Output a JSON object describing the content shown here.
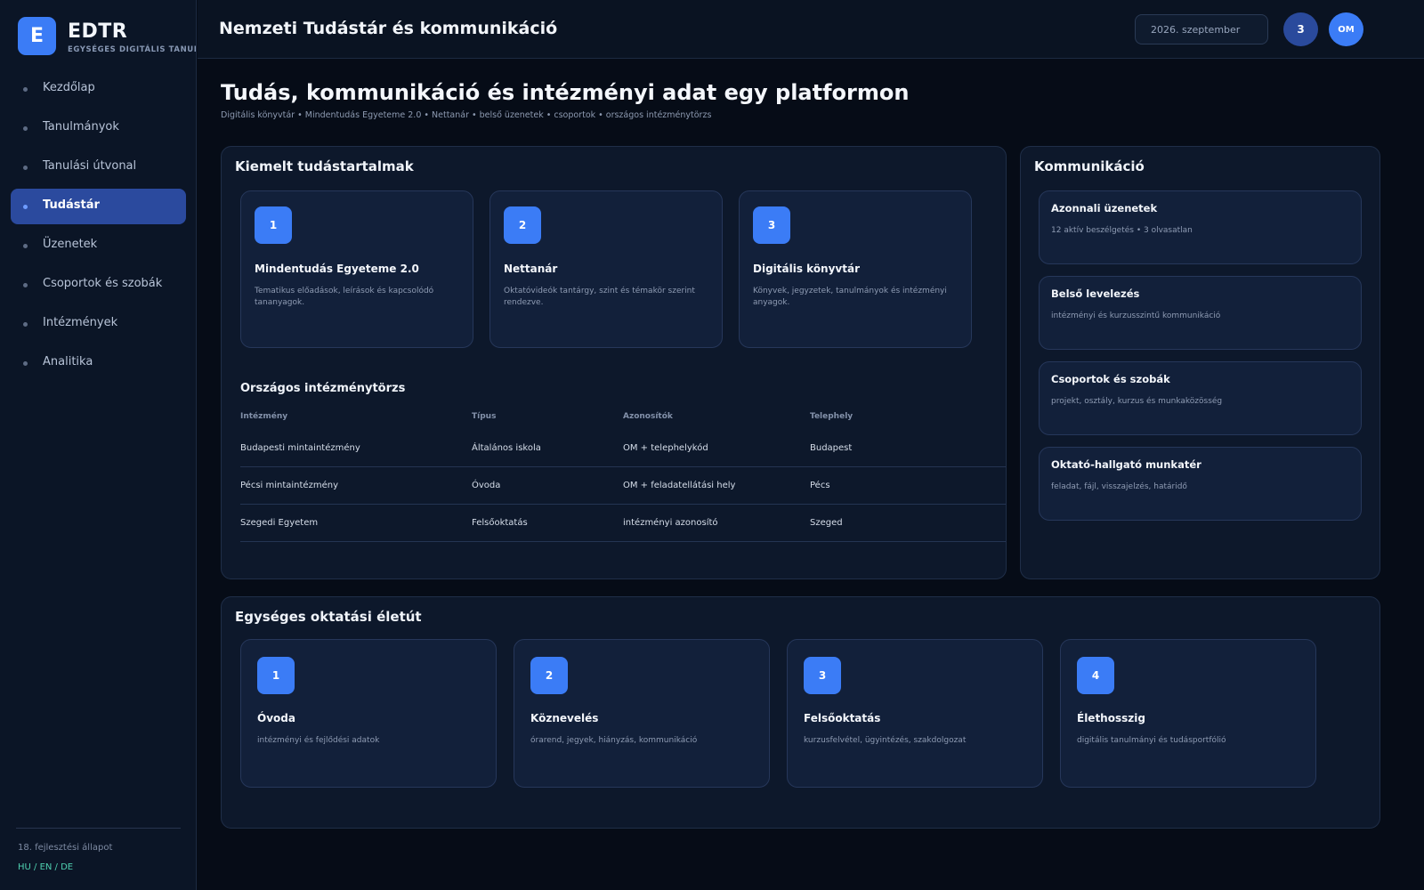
{
  "brand": {
    "logo_letter": "E",
    "name": "EDTR",
    "subtitle": "EGYSÉGES DIGITÁLIS TANULMÁNYI RENDSZER"
  },
  "sidebar": {
    "items": [
      {
        "label": "Kezdőlap",
        "active": false
      },
      {
        "label": "Tanulmányok",
        "active": false
      },
      {
        "label": "Tanulási útvonal",
        "active": false
      },
      {
        "label": "Tudástár",
        "active": true
      },
      {
        "label": "Üzenetek",
        "active": false
      },
      {
        "label": "Csoportok és szobák",
        "active": false
      },
      {
        "label": "Intézmények",
        "active": false
      },
      {
        "label": "Analitika",
        "active": false
      }
    ],
    "status": "18. fejlesztési állapot",
    "languages": "HU / EN / DE"
  },
  "header": {
    "title": "Nemzeti Tudástár és kommunikáció",
    "date": "2026. szeptember",
    "notification_count": "3",
    "avatar_initials": "OM"
  },
  "main": {
    "title": "Tudás, kommunikáció és intézményi adat egy platformon",
    "subtitle": "Digitális könyvtár • Mindentudás Egyeteme 2.0 • Nettanár • belső üzenetek • csoportok • országos intézménytörzs"
  },
  "knowledge": {
    "title": "Kiemelt tudástartalmak",
    "cards": [
      {
        "num": "1",
        "title": "Mindentudás Egyeteme 2.0",
        "desc": "Tematikus előadások, leírások és kapcsolódó tananyagok."
      },
      {
        "num": "2",
        "title": "Nettanár",
        "desc": "Oktatóvideók tantárgy, szint és témakör szerint rendezve."
      },
      {
        "num": "3",
        "title": "Digitális könyvtár",
        "desc": "Könyvek, jegyzetek, tanulmányok és intézményi anyagok."
      }
    ]
  },
  "institutions": {
    "title": "Országos intézménytörzs",
    "columns": [
      "Intézmény",
      "Típus",
      "Azonosítók",
      "Telephely"
    ],
    "rows": [
      [
        "Budapesti mintaintézmény",
        "Általános iskola",
        "OM + telephelykód",
        "Budapest"
      ],
      [
        "Pécsi mintaintézmény",
        "Óvoda",
        "OM + feladatellátási hely",
        "Pécs"
      ],
      [
        "Szegedi Egyetem",
        "Felsőoktatás",
        "intézményi azonosító",
        "Szeged"
      ]
    ]
  },
  "communication": {
    "title": "Kommunikáció",
    "cards": [
      {
        "title": "Azonnali üzenetek",
        "desc": "12 aktív beszélgetés • 3 olvasatlan"
      },
      {
        "title": "Belső levelezés",
        "desc": "intézményi és kurzusszintű kommunikáció"
      },
      {
        "title": "Csoportok és szobák",
        "desc": "projekt, osztály, kurzus és munkaközösség"
      },
      {
        "title": "Oktató-hallgató munkatér",
        "desc": "feladat, fájl, visszajelzés, határidő"
      }
    ]
  },
  "lifepath": {
    "title": "Egységes oktatási életút",
    "cards": [
      {
        "num": "1",
        "title": "Óvoda",
        "desc": "intézményi és fejlődési adatok"
      },
      {
        "num": "2",
        "title": "Köznevelés",
        "desc": "órarend, jegyek, hiányzás, kommunikáció"
      },
      {
        "num": "3",
        "title": "Felsőoktatás",
        "desc": "kurzusfelvétel, ügyintézés, szakdolgozat"
      },
      {
        "num": "4",
        "title": "Élethosszig",
        "desc": "digitális tanulmányi és tudásportfólió"
      }
    ]
  },
  "colors": {
    "accent": "#3b7cf6",
    "active_nav": "#2b4a9e",
    "background": "#060c17",
    "language_link": "#4fd0b0"
  }
}
